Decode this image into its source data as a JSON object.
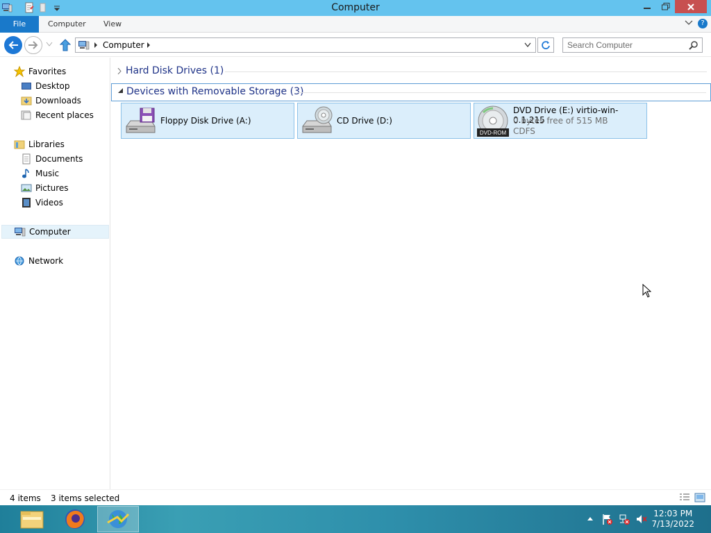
{
  "window": {
    "title": "Computer"
  },
  "ribbon": {
    "tabs": [
      "File",
      "Computer",
      "View"
    ]
  },
  "address": {
    "crumb": "Computer",
    "search_placeholder": "Search Computer"
  },
  "navpane": {
    "favorites": "Favorites",
    "desktop": "Desktop",
    "downloads": "Downloads",
    "recent_places": "Recent places",
    "libraries": "Libraries",
    "documents": "Documents",
    "music": "Music",
    "pictures": "Pictures",
    "videos": "Videos",
    "computer": "Computer",
    "network": "Network"
  },
  "content": {
    "groups": [
      {
        "label": "Hard Disk Drives (1)",
        "expanded": false
      },
      {
        "label": "Devices with Removable Storage (3)",
        "expanded": true
      }
    ],
    "devices": [
      {
        "name": "Floppy Disk Drive (A:)",
        "icon": "floppy-drive-icon"
      },
      {
        "name": "CD Drive (D:)",
        "icon": "cd-drive-icon"
      },
      {
        "name": "DVD Drive (E:) virtio-win-0.1.215",
        "free": "0 bytes free of 515 MB",
        "fs": "CDFS",
        "badge": "DVD-ROM",
        "icon": "dvd-disc-icon"
      }
    ]
  },
  "status": {
    "items": "4 items",
    "selected": "3 items selected"
  },
  "taskbar": {
    "time": "12:03 PM",
    "date": "7/13/2022"
  },
  "colors": {
    "titlebar": "#64c3ee",
    "file_tab": "#1979ca",
    "tile_bg": "#dbeefb",
    "group_text": "#1e3287"
  }
}
